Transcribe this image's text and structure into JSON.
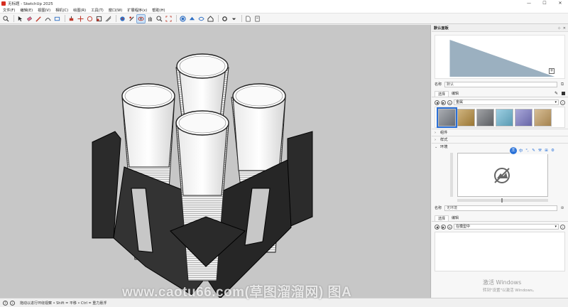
{
  "window": {
    "title": "无标题 - SketchUp 2025",
    "controls": [
      "—",
      "☐",
      "✕"
    ]
  },
  "menu": [
    "文件(F)",
    "编辑(E)",
    "视图(V)",
    "相机(C)",
    "绘图(R)",
    "工具(T)",
    "窗口(W)",
    "扩展程序(x)",
    "帮助(H)"
  ],
  "toolbar": {
    "buttons": [
      "search-icon",
      "select-icon",
      "eraser-icon",
      "pencil-icon",
      "arc-icon",
      "rectangle-icon",
      "pushpull-icon",
      "move-icon",
      "rotate-icon",
      "scale-icon",
      "offset-icon",
      "paint-icon",
      "orbit-icon",
      "pan-icon",
      "zoom-icon",
      "zoom-extents-icon",
      "component-icon",
      "section-icon",
      "xray-icon",
      "warehouse-icon",
      "document-icon",
      "settings-icon"
    ]
  },
  "panel": {
    "title": "默认面板",
    "styles": {
      "name_label": "名称",
      "name_value": "默认"
    },
    "materials": {
      "tabs": [
        "选择",
        "编辑"
      ],
      "category": "金属",
      "swatch_colors": [
        "#7b8088",
        "#b58b3c",
        "#6d7075",
        "#69b5d2",
        "#7a78c4",
        "#c19a5d"
      ]
    },
    "sections": [
      "组件",
      "样式",
      "环境"
    ],
    "environment": {
      "name_label": "名称",
      "name_value": "无环境"
    },
    "scene": {
      "tabs": [
        "选择",
        "编辑"
      ],
      "dropdown": "在模型中"
    }
  },
  "ime": {
    "main": "王",
    "items": [
      "中",
      "°,",
      "✎",
      "⚒",
      "⊞",
      "⚙"
    ]
  },
  "status": {
    "text": "拖动以进行环绕视察 • Shift = 平移 • Ctrl = 重力悬浮"
  },
  "watermark": "www.caotu66.com(草图溜溜网) 图A",
  "activation": {
    "line1": "激活 Windows",
    "line2": "转到\"设置\"以激活 Windows。"
  }
}
